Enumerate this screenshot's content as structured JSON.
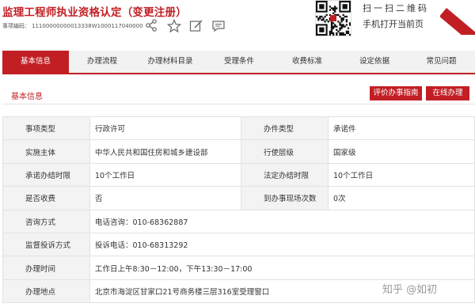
{
  "header": {
    "title": "监理工程师执业资格认定（变更注册）",
    "code_label": "事项编码：",
    "code_value": "11100000000013338W1000117040000",
    "scan_text": "扫一扫二维码",
    "scan_sub": "手机打开当前页"
  },
  "tabs": [
    {
      "label": "基本信息",
      "active": true
    },
    {
      "label": "办理流程"
    },
    {
      "label": "办理材料目录"
    },
    {
      "label": "受理条件"
    },
    {
      "label": "收费标准"
    },
    {
      "label": "设定依据"
    },
    {
      "label": "常见问题"
    }
  ],
  "section": {
    "title": "基本信息",
    "guide_button": "评价办事指南",
    "online_button": "在线办理"
  },
  "table": {
    "rows": [
      {
        "k1": "事项类型",
        "v1": "行政许可",
        "k2": "办件类型",
        "v2": "承诺件"
      },
      {
        "k1": "实施主体",
        "v1": "中华人民共和国住房和城乡建设部",
        "k2": "行使层级",
        "v2": "国家级"
      },
      {
        "k1": "承诺办结时限",
        "v1": "10个工作日",
        "k2": "法定办结时限",
        "v2": "10个工作日"
      },
      {
        "k1": "是否收费",
        "v1": "否",
        "k2": "到办事现场次数",
        "v2": "0次"
      },
      {
        "k1": "咨询方式",
        "v1": "电话咨询：010-68362887"
      },
      {
        "k1": "监督投诉方式",
        "v1": "投诉电话：010-68313292"
      },
      {
        "k1": "办理时间",
        "v1": "工作日上午8:30－12:00，下午13:30－17:00"
      },
      {
        "k1": "办理地点",
        "v1": "北京市海淀区甘家口21号商务楼三层316室受理窗口"
      }
    ]
  },
  "watermark": "知乎 @如初",
  "colors": {
    "accent": "#c11f24",
    "label_bg": "#f3f3f3"
  }
}
